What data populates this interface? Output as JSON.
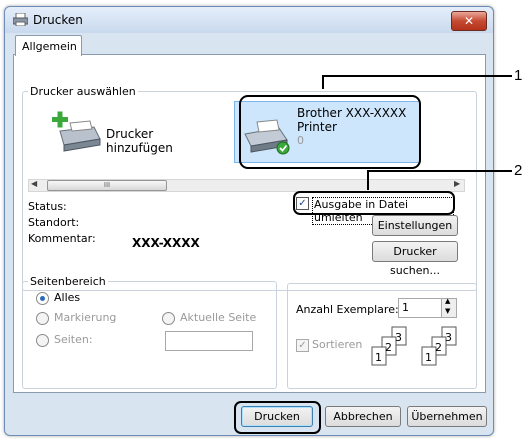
{
  "window": {
    "title": "Drucken",
    "close_label": "✕",
    "tab": "Allgemein"
  },
  "printer_select": {
    "legend": "Drucker auswählen",
    "add_printer": "Drucker hinzufügen",
    "selected_printer": {
      "name": "Brother XXX-XXXX",
      "type": "Printer",
      "count": "0"
    },
    "scroll_thumb": "III"
  },
  "status": {
    "status_label": "Status:",
    "location_label": "Standort:",
    "comment_label": "Kommentar:",
    "comment_value": "XXX-XXXX",
    "print_to_file": "Ausgabe in Datei umleiten",
    "print_to_file_checked": true,
    "settings_button": "Einstellungen",
    "find_printer_button": "Drucker suchen..."
  },
  "page_range": {
    "legend": "Seitenbereich",
    "all": "Alles",
    "selection": "Markierung",
    "current_page": "Aktuelle Seite",
    "pages": "Seiten:",
    "selected": "all"
  },
  "copies": {
    "label": "Anzahl Exemplare:",
    "value": "1",
    "collate": "Sortieren"
  },
  "buttons": {
    "print": "Drucken",
    "cancel": "Abbrechen",
    "apply": "Übernehmen"
  },
  "callouts": {
    "one": "1",
    "two": "2"
  }
}
